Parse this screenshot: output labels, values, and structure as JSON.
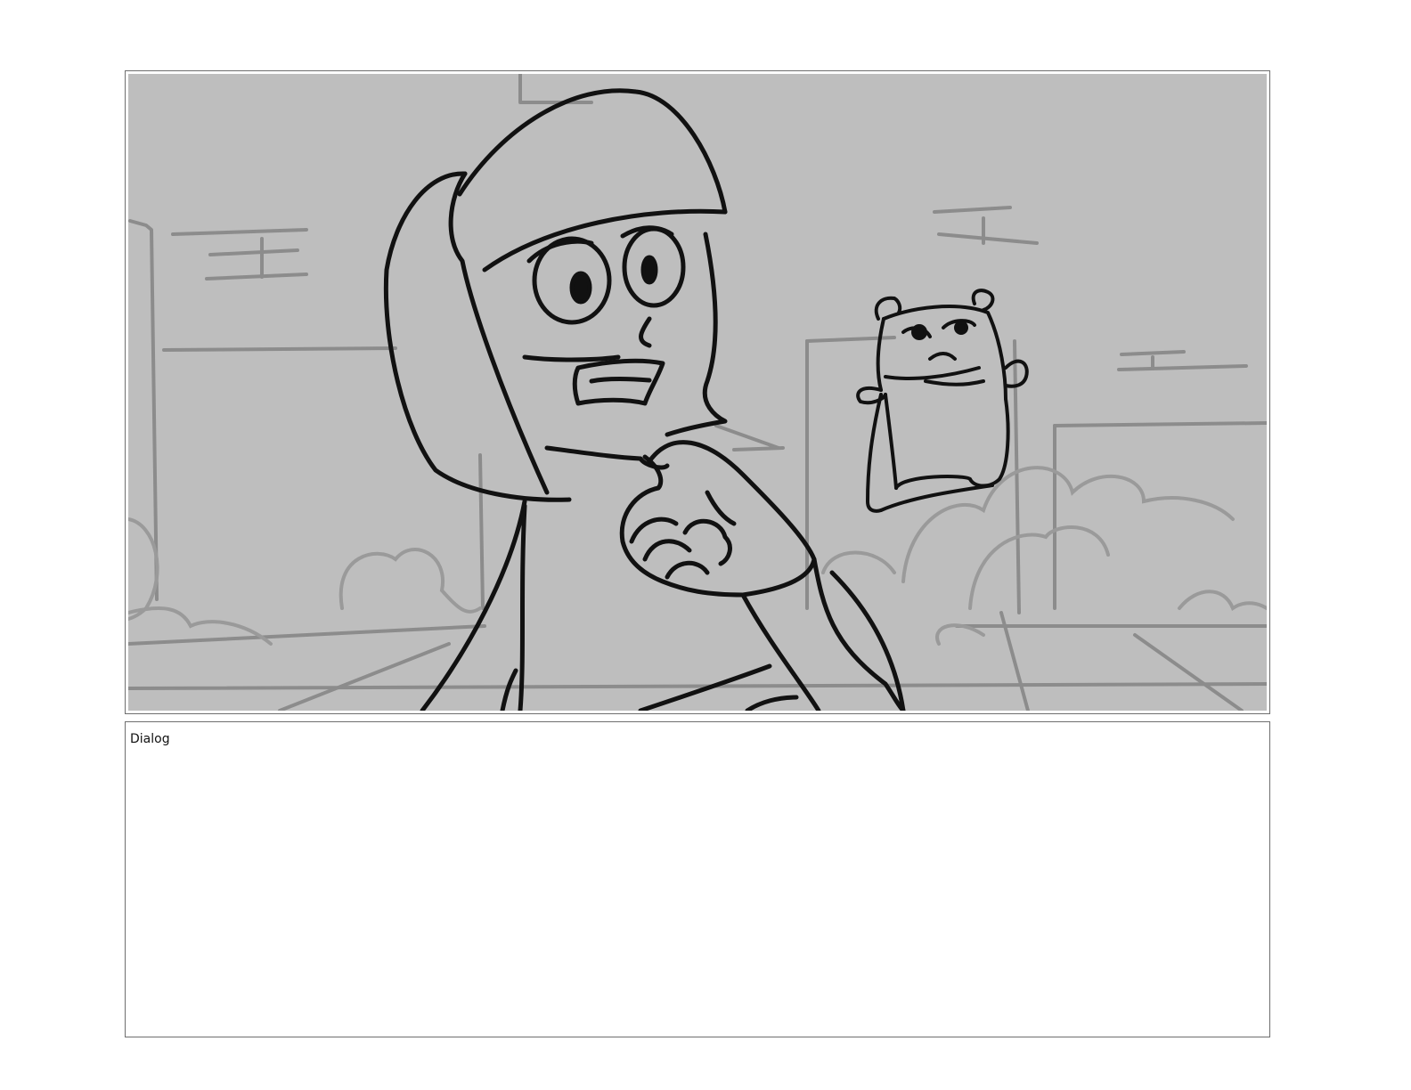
{
  "panel": {
    "background_color": "#bebebe",
    "line_color": "#111111",
    "background_line_color": "#8c8c8c"
  },
  "dialog": {
    "label": "Dialog"
  }
}
